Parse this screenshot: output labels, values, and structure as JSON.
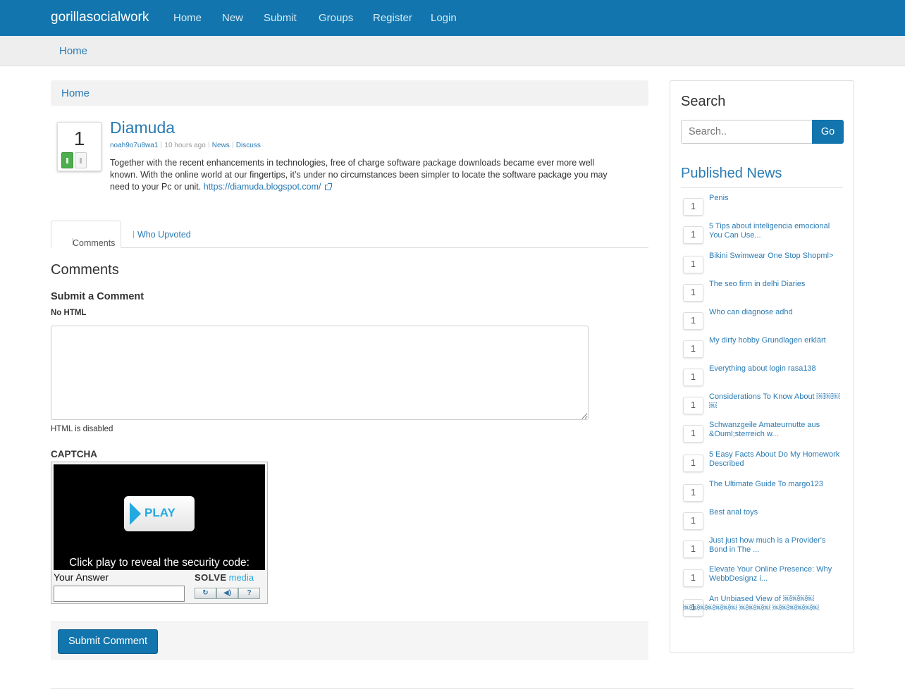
{
  "navbar": {
    "brand": "gorillasocialwork",
    "items": [
      "Home",
      "New",
      "Submit",
      "Groups",
      "Register",
      "Login"
    ]
  },
  "subnav": {
    "home": "Home"
  },
  "breadcrumb": {
    "home": "Home"
  },
  "post": {
    "votes": "1",
    "title": "Diamuda",
    "author": "noah9o7u8wa1",
    "time": "10 hours ago",
    "category": "News",
    "discuss": "Discuss",
    "body": "Together with the recent enhancements in technologies, free of charge software package downloads became ever more well known. With the online world at our fingertips, it’s under no circumstances been simpler to locate the software package you may need to your Pc or unit.",
    "link": "https://diamuda.blogspot.com/"
  },
  "tabs": {
    "comments": "Comments",
    "who_upvoted": "Who Upvoted"
  },
  "comments_section": {
    "heading": "Comments",
    "submit_heading": "Submit a Comment",
    "no_html_label": "No HTML",
    "html_disabled": "HTML is disabled",
    "captcha_heading": "CAPTCHA"
  },
  "captcha": {
    "play_label": "PLAY",
    "message": "Click play to reveal the security code:",
    "answer_label": "Your Answer",
    "logo_part1": "SOLVE",
    "logo_part2": "media",
    "buttons": [
      "↻",
      "◀)",
      "?"
    ]
  },
  "submit_button": "Submit Comment",
  "sidebar": {
    "search_title": "Search",
    "search_placeholder": "Search..",
    "go_label": "Go",
    "published_title": "Published News",
    "news": [
      {
        "count": "1",
        "title": "Penis"
      },
      {
        "count": "1",
        "title": "5 Tips about inteligencia emocional You Can Use..."
      },
      {
        "count": "1",
        "title": "Bikini Swimwear One Stop Shopml>"
      },
      {
        "count": "1",
        "title": "The seo firm in delhi Diaries"
      },
      {
        "count": "1",
        "title": "Who can diagnose adhd"
      },
      {
        "count": "1",
        "title": "My dirty hobby Grundlagen erklärt"
      },
      {
        "count": "1",
        "title": "Everything about login rasa138"
      },
      {
        "count": "1",
        "title": "Considerations To Know About ￼￼￼￼"
      },
      {
        "count": "1",
        "title": "Schwanzgeile Amateurnutte aus &Ouml;sterreich w..."
      },
      {
        "count": "1",
        "title": "5 Easy Facts About Do My Homework Described"
      },
      {
        "count": "1",
        "title": "The Ultimate Guide To margo123"
      },
      {
        "count": "1",
        "title": "Best anal toys"
      },
      {
        "count": "1",
        "title": "Just just how much is a Provider's Bond in The ..."
      },
      {
        "count": "1",
        "title": "Elevate Your Online Presence: Why WebbDesignz i..."
      },
      {
        "count": "1",
        "title": "An Unbiased View of ￼￼￼￼ ￼￼￼￼￼￼￼ ￼￼￼￼ ￼￼￼￼￼￼"
      }
    ]
  }
}
